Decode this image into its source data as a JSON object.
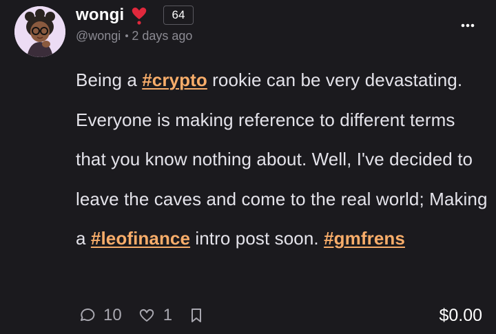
{
  "author": {
    "name": "wongi",
    "handle": "@wongi",
    "badge": "heart-emoji",
    "reputation": "64"
  },
  "post": {
    "time": "2 days ago",
    "text": {
      "p1": "Being a ",
      "tag1": "#crypto",
      "p2": " rookie can be very devastating. Everyone is making reference to different terms that you know nothing about. Well, I've decided to leave the caves and come to the real world; Making a ",
      "tag2": "#leofinance",
      "p3": " intro post soon. ",
      "tag3": "#gmfrens"
    }
  },
  "actions": {
    "comments": "10",
    "likes": "1",
    "payout": "$0.00"
  },
  "icons": [
    "avatar-image",
    "heart-emoji-icon",
    "more-icon",
    "comment-icon",
    "like-icon",
    "bookmark-icon"
  ],
  "colors": {
    "background": "#1b1a1e",
    "text": "#e4e3ea",
    "muted": "#8b8a92",
    "hashtag": "#f8ad6a",
    "heart": "#e0283c"
  }
}
